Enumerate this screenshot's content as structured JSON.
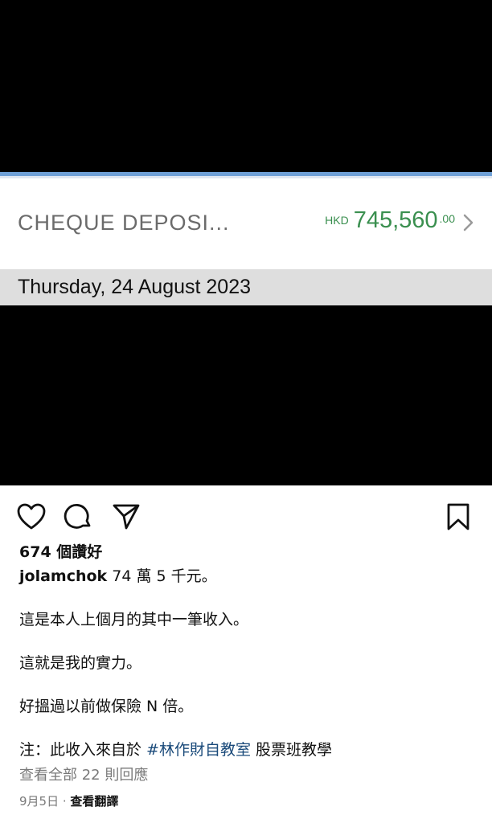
{
  "transaction": {
    "description": "CHEQUE DEPOSI...",
    "currency": "HKD",
    "amount": "745,560",
    "cents": ".00",
    "amount_color": "#3a8f4f"
  },
  "date_header": {
    "text": "Thursday, 24 August 2023"
  },
  "actions": {
    "icons": [
      "heart-icon",
      "comment-icon",
      "share-icon",
      "bookmark-icon"
    ]
  },
  "post": {
    "likes": "674 個讚好",
    "username": "jolamchok",
    "caption_first": " 74 萬 5 千元。",
    "line2": "這是本人上個月的其中一筆收入。",
    "line3": "這就是我的實力。",
    "line4": "好搵過以前做保險 N 倍。",
    "note_prefix": "注：此收入來自於 ",
    "hashtag": "#林作財自教室",
    "note_suffix": " 股票班教學",
    "view_comments": "查看全部 22 則回應",
    "date": "9月5日",
    "separator": " · ",
    "translate": "查看翻譯"
  }
}
